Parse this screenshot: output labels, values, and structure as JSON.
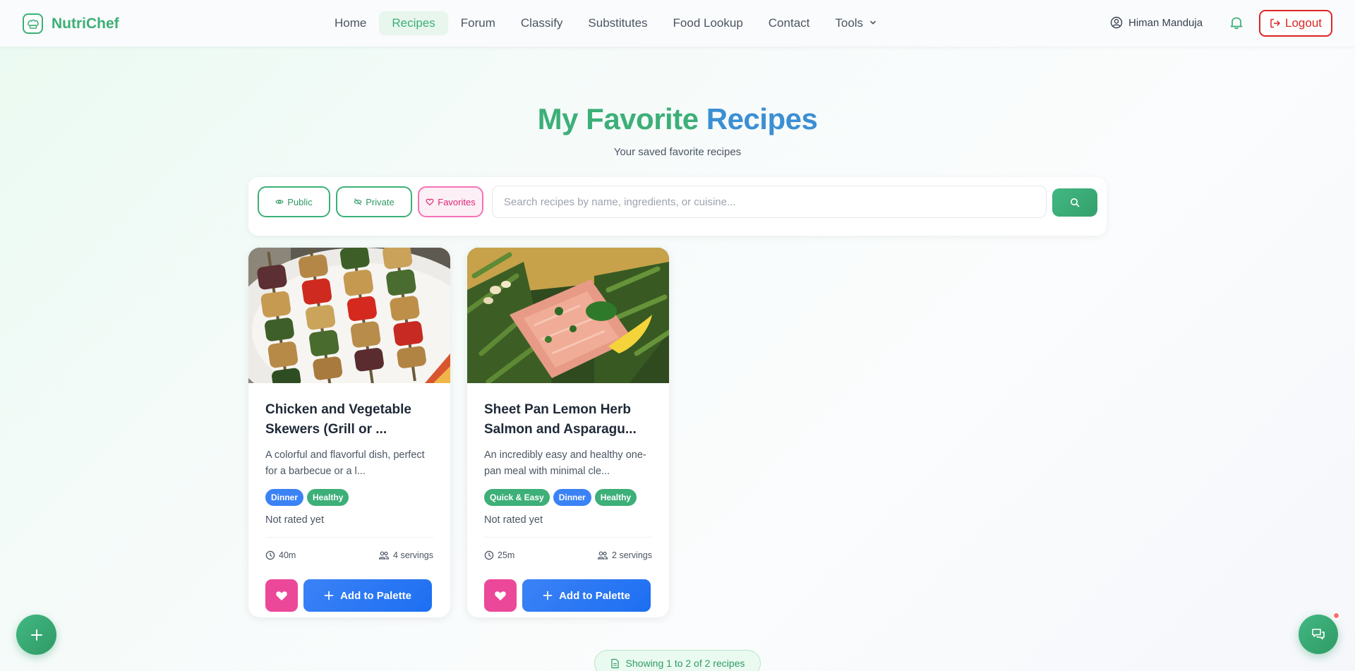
{
  "nav": {
    "brand": "NutriChef",
    "links": [
      {
        "label": "Home"
      },
      {
        "label": "Recipes"
      },
      {
        "label": "Forum"
      },
      {
        "label": "Classify"
      },
      {
        "label": "Substitutes"
      },
      {
        "label": "Food Lookup"
      },
      {
        "label": "Contact"
      },
      {
        "label": "Tools"
      }
    ],
    "active_link": "Recipes",
    "user_name": "Himan Manduja",
    "logout_label": "Logout"
  },
  "header": {
    "title_part1": "My Favorite",
    "title_part2": "Recipes",
    "subtitle": "Your saved favorite recipes"
  },
  "filters": {
    "public_label": "Public",
    "private_label": "Private",
    "favorites_label": "Favorites",
    "active_filter": "Favorites",
    "search_placeholder": "Search recipes by name, ingredients, or cuisine...",
    "search_value": ""
  },
  "recipes": [
    {
      "title": "Chicken and Vegetable Skewers (Grill or ...",
      "description": "A colorful and flavorful dish, perfect for a barbecue or a l...",
      "tags": [
        {
          "label": "Dinner",
          "color": "#3b82f6"
        },
        {
          "label": "Healthy",
          "color": "#3daf78"
        }
      ],
      "rating_text": "Not rated yet",
      "time": "40m",
      "servings": "4 servings",
      "favorited": true,
      "action_label": "Add to Palette"
    },
    {
      "title": "Sheet Pan Lemon Herb Salmon and Asparagu...",
      "description": "An incredibly easy and healthy one-pan meal with minimal cle...",
      "tags": [
        {
          "label": "Quick & Easy",
          "color": "#3daf78"
        },
        {
          "label": "Dinner",
          "color": "#3b82f6"
        },
        {
          "label": "Healthy",
          "color": "#3daf78"
        }
      ],
      "rating_text": "Not rated yet",
      "time": "25m",
      "servings": "2 servings",
      "favorited": true,
      "action_label": "Add to Palette"
    }
  ],
  "pagination": {
    "showing_text": "Showing 1 to 2 of 2 recipes"
  },
  "colors": {
    "brand_green": "#3daf78",
    "accent_blue": "#3b82f6",
    "favorite_pink": "#ec4899",
    "logout_red": "#dc2626"
  },
  "icons": {
    "brand": "chef-hat-icon",
    "user": "user-circle-icon",
    "notifications": "bell-icon",
    "logout": "logout-icon",
    "fab_left": "plus-icon",
    "fab_right": "chat-icon"
  }
}
